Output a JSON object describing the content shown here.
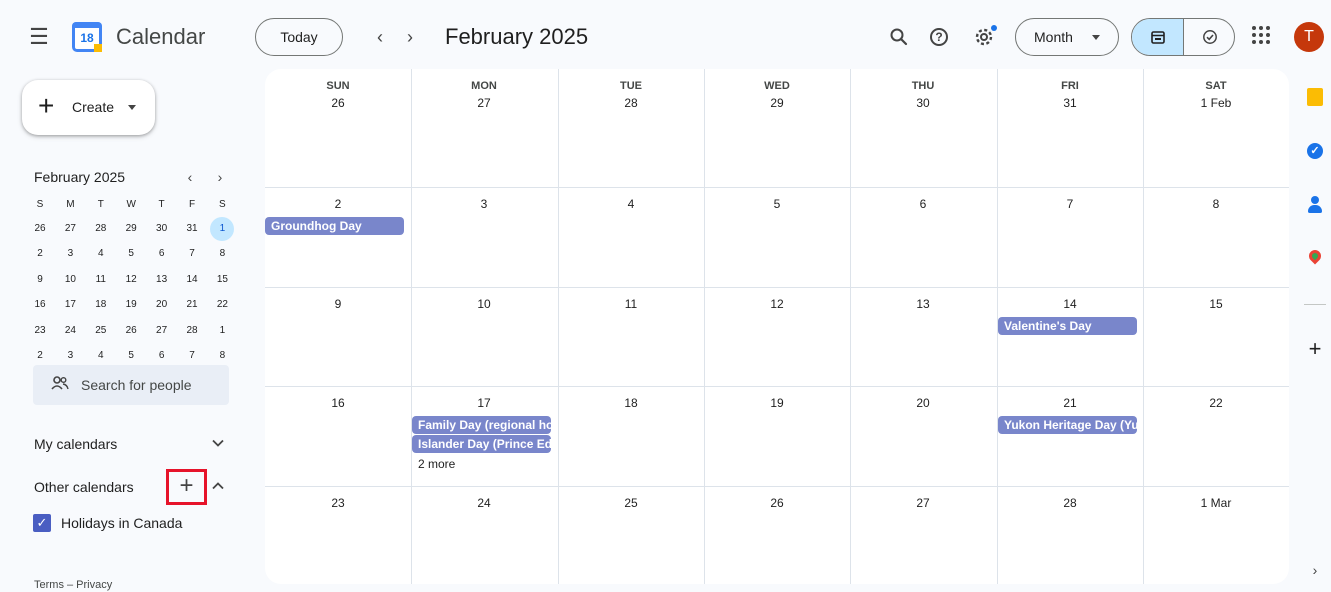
{
  "header": {
    "logo_number": "18",
    "app_title": "Calendar",
    "today_label": "Today",
    "prev_icon": "‹",
    "next_icon": "›",
    "month_title": "February 2025",
    "view_select": "Month",
    "avatar_initial": "T",
    "icons": [
      "menu-icon",
      "search-icon",
      "help-icon",
      "settings-icon",
      "calendar-view-icon",
      "tasks-view-icon",
      "apps-grid-icon"
    ]
  },
  "sidebar": {
    "create_label": "Create",
    "mini_calendar": {
      "title": "February 2025",
      "weekdays": [
        "S",
        "M",
        "T",
        "W",
        "T",
        "F",
        "S"
      ],
      "weeks": [
        [
          "26",
          "27",
          "28",
          "29",
          "30",
          "31",
          "1"
        ],
        [
          "2",
          "3",
          "4",
          "5",
          "6",
          "7",
          "8"
        ],
        [
          "9",
          "10",
          "11",
          "12",
          "13",
          "14",
          "15"
        ],
        [
          "16",
          "17",
          "18",
          "19",
          "20",
          "21",
          "22"
        ],
        [
          "23",
          "24",
          "25",
          "26",
          "27",
          "28",
          "1"
        ],
        [
          "2",
          "3",
          "4",
          "5",
          "6",
          "7",
          "8"
        ]
      ],
      "selected": "1"
    },
    "search_people_placeholder": "Search for people",
    "my_calendars_label": "My calendars",
    "other_calendars_label": "Other calendars",
    "add_calendar_icon": "+",
    "calendars": [
      {
        "name": "Holidays in Canada",
        "checked": true,
        "color": "#4a5ec2"
      }
    ],
    "footer": "Terms – Privacy"
  },
  "month_grid": {
    "weekdays": [
      "SUN",
      "MON",
      "TUE",
      "WED",
      "THU",
      "FRI",
      "SAT"
    ],
    "weeks": [
      [
        "26",
        "27",
        "28",
        "29",
        "30",
        "31",
        "1 Feb"
      ],
      [
        "2",
        "3",
        "4",
        "5",
        "6",
        "7",
        "8"
      ],
      [
        "9",
        "10",
        "11",
        "12",
        "13",
        "14",
        "15"
      ],
      [
        "16",
        "17",
        "18",
        "19",
        "20",
        "21",
        "22"
      ],
      [
        "23",
        "24",
        "25",
        "26",
        "27",
        "28",
        "1 Mar"
      ]
    ],
    "events": [
      {
        "week": 1,
        "day": 0,
        "slot": 0,
        "title": "Groundhog Day"
      },
      {
        "week": 2,
        "day": 5,
        "slot": 0,
        "title": "Valentine's Day"
      },
      {
        "week": 3,
        "day": 1,
        "slot": 0,
        "title": "Family Day (regional ho"
      },
      {
        "week": 3,
        "day": 1,
        "slot": 1,
        "title": "Islander Day (Prince Ed"
      },
      {
        "week": 3,
        "day": 5,
        "slot": 0,
        "title": "Yukon Heritage Day (Yu"
      }
    ],
    "more": [
      {
        "week": 3,
        "day": 1,
        "label": "2 more"
      }
    ],
    "event_color": "#7986cb"
  },
  "right_rail": {
    "icons": [
      "keep-icon",
      "tasks-icon",
      "contacts-icon",
      "maps-icon"
    ],
    "add_icon": "+",
    "expand_icon": "›"
  }
}
